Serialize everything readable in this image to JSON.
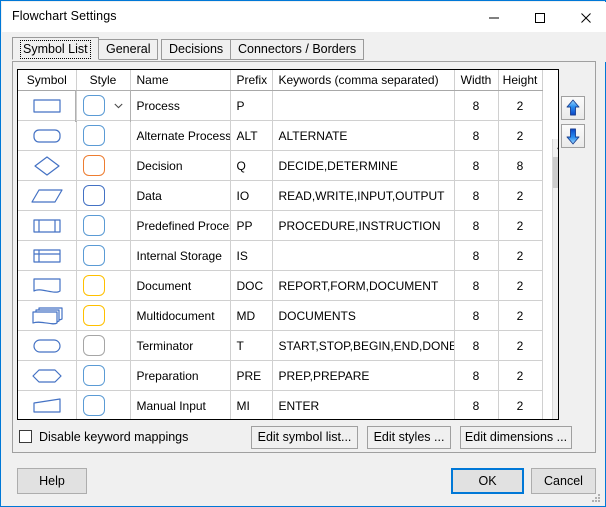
{
  "window": {
    "title": "Flowchart Settings",
    "accent_color": "#0078d7",
    "controls": {
      "minimize": "minimize-icon",
      "maximize": "maximize-icon",
      "close": "close-icon"
    }
  },
  "tabs": [
    {
      "label": "Symbol List",
      "active": true
    },
    {
      "label": "General",
      "active": false
    },
    {
      "label": "Decisions",
      "active": false
    },
    {
      "label": "Connectors / Borders",
      "active": false
    }
  ],
  "grid": {
    "columns": [
      "Symbol",
      "Style",
      "Name",
      "Prefix",
      "Keywords (comma separated)",
      "Width",
      "Height"
    ],
    "selected_cell": {
      "row": 0,
      "column": "Keywords (comma separated)",
      "value": "",
      "highlight_color": "#3399f5"
    },
    "rows": [
      {
        "symbol": "process",
        "style_color": "#5b9bd5",
        "has_dropdown": true,
        "name": "Process",
        "prefix": "P",
        "keywords": "",
        "width": "8",
        "height": "2"
      },
      {
        "symbol": "alternate-process",
        "style_color": "#5b9bd5",
        "has_dropdown": false,
        "name": "Alternate Process",
        "prefix": "ALT",
        "keywords": "ALTERNATE",
        "width": "8",
        "height": "2"
      },
      {
        "symbol": "decision",
        "style_color": "#ed7d31",
        "has_dropdown": false,
        "name": "Decision",
        "prefix": "Q",
        "keywords": "DECIDE,DETERMINE",
        "width": "8",
        "height": "8"
      },
      {
        "symbol": "data",
        "style_color": "#4472c4",
        "has_dropdown": false,
        "name": "Data",
        "prefix": "IO",
        "keywords": "READ,WRITE,INPUT,OUTPUT",
        "width": "8",
        "height": "2"
      },
      {
        "symbol": "predefined-process",
        "style_color": "#5b9bd5",
        "has_dropdown": false,
        "name": "Predefined Process",
        "prefix": "PP",
        "keywords": "PROCEDURE,INSTRUCTION",
        "width": "8",
        "height": "2"
      },
      {
        "symbol": "internal-storage",
        "style_color": "#5b9bd5",
        "has_dropdown": false,
        "name": "Internal Storage",
        "prefix": "IS",
        "keywords": "",
        "width": "8",
        "height": "2"
      },
      {
        "symbol": "document",
        "style_color": "#ffc000",
        "has_dropdown": false,
        "name": "Document",
        "prefix": "DOC",
        "keywords": "REPORT,FORM,DOCUMENT",
        "width": "8",
        "height": "2"
      },
      {
        "symbol": "multidocument",
        "style_color": "#ffc000",
        "has_dropdown": false,
        "name": "Multidocument",
        "prefix": "MD",
        "keywords": "DOCUMENTS",
        "width": "8",
        "height": "2"
      },
      {
        "symbol": "terminator",
        "style_color": "#a6a6a6",
        "has_dropdown": false,
        "name": "Terminator",
        "prefix": "T",
        "keywords": "START,STOP,BEGIN,END,DONE",
        "width": "8",
        "height": "2"
      },
      {
        "symbol": "preparation",
        "style_color": "#5b9bd5",
        "has_dropdown": false,
        "name": "Preparation",
        "prefix": "PRE",
        "keywords": "PREP,PREPARE",
        "width": "8",
        "height": "2"
      },
      {
        "symbol": "manual-input",
        "style_color": "#5b9bd5",
        "has_dropdown": false,
        "name": "Manual Input",
        "prefix": "MI",
        "keywords": "ENTER",
        "width": "8",
        "height": "2"
      },
      {
        "symbol": "partial-row",
        "style_color": "#5b9bd5",
        "has_dropdown": false,
        "name": "",
        "prefix": "",
        "keywords": "",
        "width": "",
        "height": ""
      }
    ]
  },
  "reorder": {
    "move_up": "arrow-up-icon",
    "move_down": "arrow-down-icon"
  },
  "scrollbar": {
    "up": "scroll-up-arrow-icon",
    "down": "scroll-down-arrow-icon",
    "thumb_position": "top"
  },
  "options": {
    "disable_keyword_mappings": {
      "label": "Disable keyword mappings",
      "checked": false
    }
  },
  "panel_buttons": {
    "edit_symbol_list": "Edit symbol list...",
    "edit_styles": "Edit styles ...",
    "edit_dimensions": "Edit dimensions ..."
  },
  "footer": {
    "help": "Help",
    "ok": "OK",
    "cancel": "Cancel"
  }
}
